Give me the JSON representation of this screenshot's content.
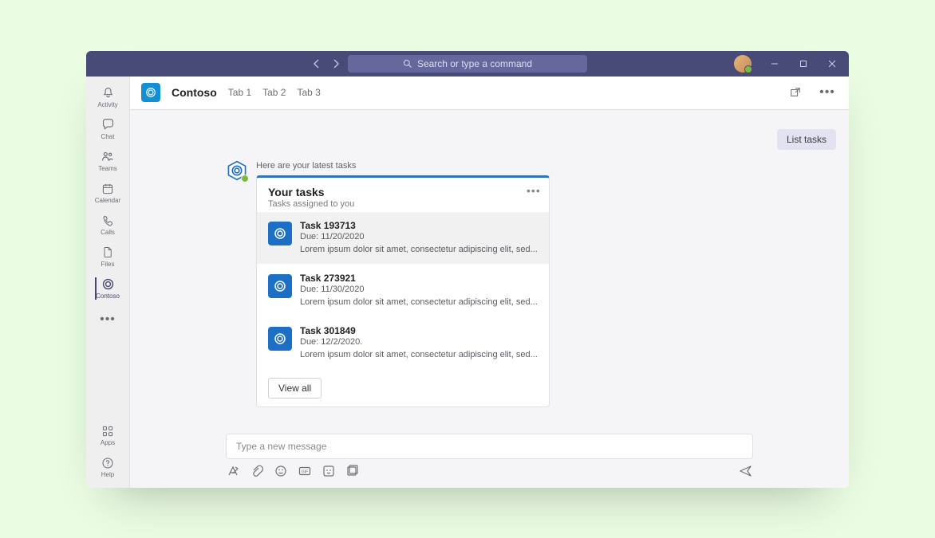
{
  "titlebar": {
    "search_placeholder": "Search or type a command"
  },
  "rail": {
    "items": [
      {
        "label": "Activity",
        "icon": "bell"
      },
      {
        "label": "Chat",
        "icon": "chat"
      },
      {
        "label": "Teams",
        "icon": "teams"
      },
      {
        "label": "Calendar",
        "icon": "calendar"
      },
      {
        "label": "Calls",
        "icon": "calls"
      },
      {
        "label": "Files",
        "icon": "files"
      },
      {
        "label": "Contoso",
        "icon": "contoso",
        "selected": true
      }
    ],
    "bottom": [
      {
        "label": "Apps",
        "icon": "apps"
      },
      {
        "label": "Help",
        "icon": "help"
      }
    ]
  },
  "tabbar": {
    "app_name": "Contoso",
    "tabs": [
      {
        "label": "Tab 1"
      },
      {
        "label": "Tab 2"
      },
      {
        "label": "Tab 3"
      }
    ]
  },
  "chat": {
    "user_message": "List tasks",
    "bot_preamble": "Here are your latest tasks",
    "card": {
      "title": "Your tasks",
      "subtitle": "Tasks assigned to you",
      "tasks": [
        {
          "title": "Task 193713",
          "due": "Due: 11/20/2020",
          "desc": "Lorem ipsum dolor sit amet, consectetur adipiscing elit, sed...",
          "selected": true
        },
        {
          "title": "Task 273921",
          "due": "Due: 11/30/2020",
          "desc": "Lorem ipsum dolor sit amet, consectetur adipiscing elit, sed..."
        },
        {
          "title": "Task 301849",
          "due": "Due: 12/2/2020.",
          "desc": "Lorem ipsum dolor sit amet, consectetur adipiscing elit, sed..."
        }
      ],
      "view_all_label": "View all"
    }
  },
  "compose": {
    "placeholder": "Type a new message"
  }
}
